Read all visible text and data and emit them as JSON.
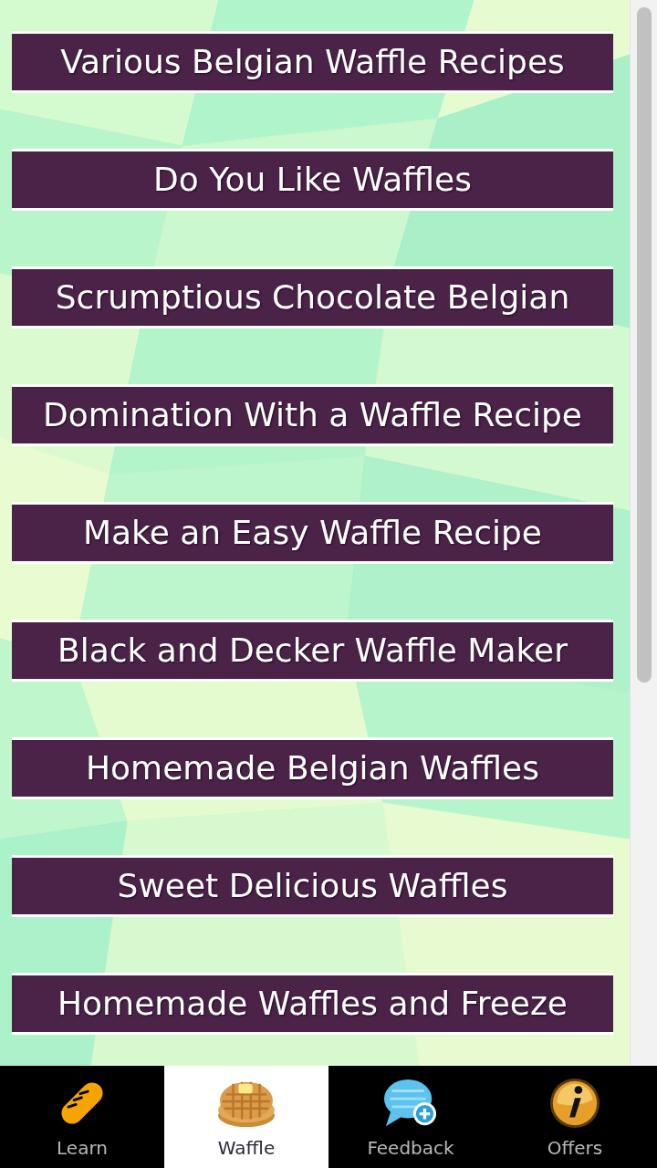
{
  "recipes": [
    {
      "title": "Various Belgian Waffle Recipes"
    },
    {
      "title": "Do You Like Waffles"
    },
    {
      "title": "Scrumptious Chocolate Belgian"
    },
    {
      "title": "Domination With a Waffle Recipe"
    },
    {
      "title": "Make an Easy Waffle Recipe"
    },
    {
      "title": "Black and Decker Waffle Maker"
    },
    {
      "title": "Homemade Belgian Waffles"
    },
    {
      "title": "Sweet Delicious Waffles"
    },
    {
      "title": "Homemade Waffles and Freeze"
    }
  ],
  "tab_bar": {
    "tabs": [
      {
        "label": "Learn",
        "selected": false
      },
      {
        "label": "Waffle",
        "selected": true
      },
      {
        "label": "Feedback",
        "selected": false
      },
      {
        "label": "Offers",
        "selected": false
      }
    ]
  }
}
